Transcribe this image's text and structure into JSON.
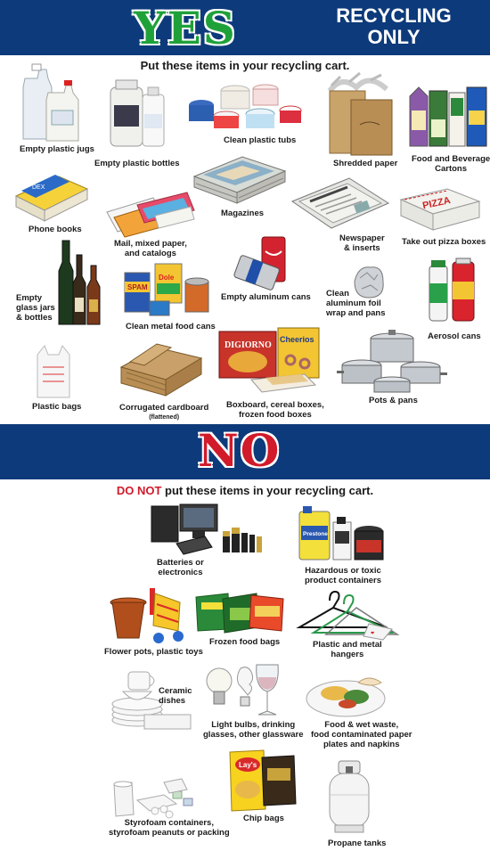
{
  "yes_section": {
    "heading": "YES",
    "tagline_line1": "RECYCLING",
    "tagline_line2": "ONLY",
    "instruction": "Put these items in your recycling cart.",
    "items": {
      "jugs": "Empty plastic jugs",
      "bottles": "Empty plastic bottles",
      "tubs": "Clean plastic tubs",
      "shredded": "Shredded paper",
      "cartons_1": "Food and Beverage",
      "cartons_2": "Cartons",
      "phonebooks": "Phone books",
      "mail_1": "Mail, mixed paper,",
      "mail_2": "and catalogs",
      "magazines": "Magazines",
      "newspaper_1": "Newspaper",
      "newspaper_2": "& inserts",
      "pizza": "Take out pizza boxes",
      "glass_1": "Empty",
      "glass_2": "glass jars",
      "glass_3": "& bottles",
      "metal_cans": "Clean metal food cans",
      "aluminum_cans": "Empty aluminum cans",
      "foil_1": "Clean",
      "foil_2": "aluminum foil",
      "foil_3": "wrap and pans",
      "aerosol": "Aerosol cans",
      "bags": "Plastic bags",
      "cardboard": "Corrugated cardboard",
      "cardboard_note": "(flattened)",
      "boxboard_1": "Boxboard, cereal boxes,",
      "boxboard_2": "frozen food boxes",
      "pots": "Pots & pans"
    },
    "product_text": {
      "pizza_box": "PIZZA",
      "cheerios": "Cheerios",
      "digiorno": "DIGIORNO",
      "spam": "SPAM",
      "dole": "Dole"
    }
  },
  "no_section": {
    "heading": "NO",
    "instruction_emph": "DO NOT",
    "instruction_rest": " put these items in your recycling cart.",
    "items": {
      "batteries_1": "Batteries or",
      "batteries_2": "electronics",
      "hazardous_1": "Hazardous or toxic",
      "hazardous_2": "product containers",
      "flowerpots": "Flower pots, plastic toys",
      "frozen": "Frozen food bags",
      "hangers_1": "Plastic and metal",
      "hangers_2": "hangers",
      "ceramic_1": "Ceramic",
      "ceramic_2": "dishes",
      "bulbs_1": "Light bulbs, drinking",
      "bulbs_2": "glasses, other glassware",
      "food_1": "Food & wet waste,",
      "food_2": "food contaminated paper",
      "food_3": "plates and napkins",
      "styro_1": "Styrofoam containers,",
      "styro_2": "styrofoam peanuts or packing",
      "chips": "Chip bags",
      "propane": "Propane tanks"
    },
    "product_text": {
      "prestone": "Prestone",
      "lays": "Lay's"
    }
  },
  "colors": {
    "banner": "#0d3a7a",
    "yes": "#1fa13a",
    "no": "#d11a2a"
  }
}
